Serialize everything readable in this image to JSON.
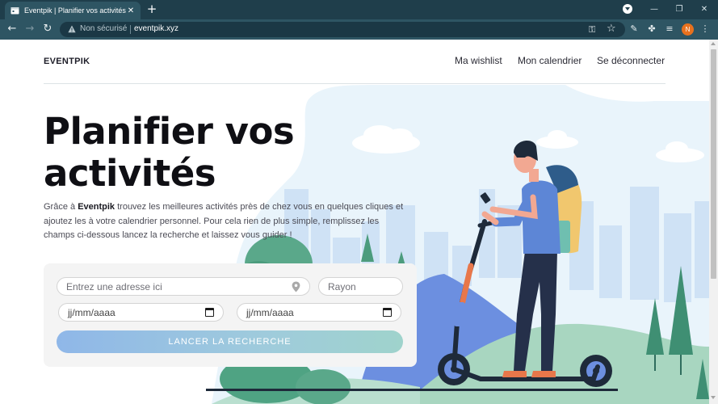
{
  "browser": {
    "tab_title": "Eventpik | Planifier vos activités",
    "tab_close_icon": "close-icon",
    "new_tab_icon": "plus-icon",
    "security_label": "Non sécurisé",
    "url": "eventpik.xyz",
    "profile_initial": "N",
    "accent_color": "#e8711e"
  },
  "nav": {
    "brand": "EVENTPIK",
    "links": [
      "Ma wishlist",
      "Mon calendrier",
      "Se déconnecter"
    ]
  },
  "hero": {
    "title": "Planifier vos activités",
    "text_before": "Grâce à ",
    "text_brand": "Eventpik",
    "text_after": " trouvez les meilleures activités près de chez vous en quelques cliques et ajoutez les à votre calendrier personnel. Pour cela rien de plus simple, remplissez les champs ci-dessous lancez la recherche et laissez vous guider !"
  },
  "search": {
    "address_placeholder": "Entrez une adresse ici",
    "radius_placeholder": "Rayon",
    "date_start": "jj/mm/aaaa",
    "date_end": "jj/mm/aaaa",
    "button_label": "LANCER LA RECHERCHE"
  }
}
